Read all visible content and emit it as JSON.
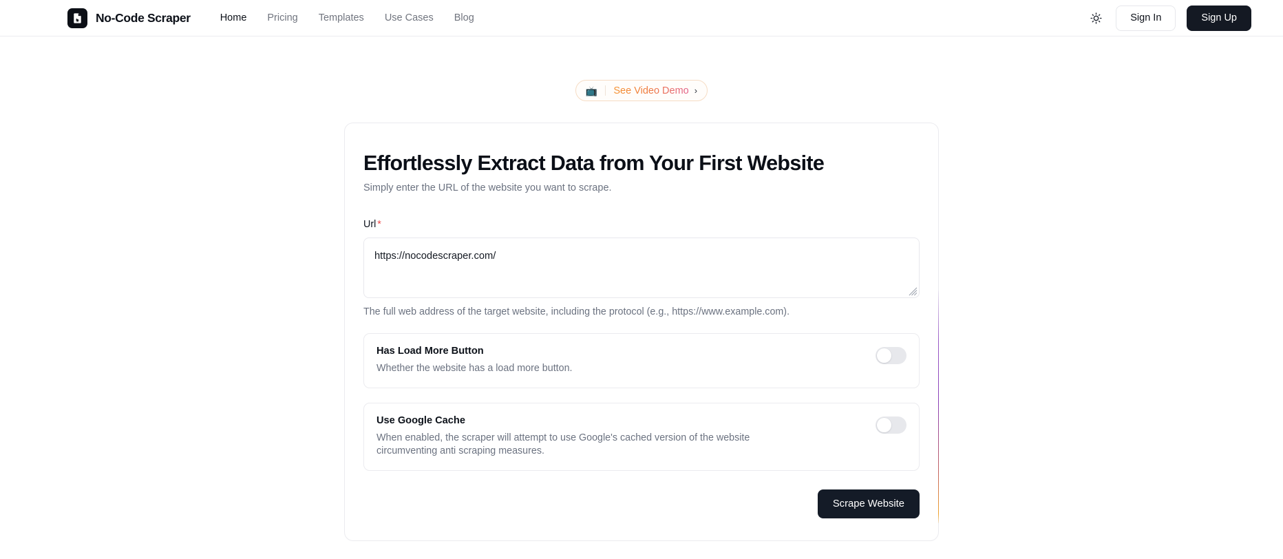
{
  "navbar": {
    "brand": {
      "name": "No-Code Scraper",
      "logo_icon": "document-refresh-icon",
      "logo_bg": "#0c0f16"
    },
    "links": [
      {
        "label": "Home",
        "active": true
      },
      {
        "label": "Pricing",
        "active": false
      },
      {
        "label": "Templates",
        "active": false
      },
      {
        "label": "Use Cases",
        "active": false
      },
      {
        "label": "Blog",
        "active": false
      }
    ],
    "theme_toggle_icon": "sun-icon",
    "sign_in_label": "Sign In",
    "sign_up_label": "Sign Up",
    "sign_up_bg": "#141923"
  },
  "demo_badge": {
    "emoji": "📺",
    "emoji_icon": "television-icon",
    "text": "See Video Demo",
    "chevron": "›",
    "chevron_icon": "chevron-right-icon",
    "gradient_from": "#f59331",
    "gradient_to": "#e2628c",
    "border_color": "#f6dcc4"
  },
  "form_card": {
    "title": "Effortlessly Extract Data from Your First Website",
    "subtitle": "Simply enter the URL of the website you want to scrape.",
    "edge_gradient_top": "#9a59c7",
    "edge_gradient_bottom": "#f0a32c",
    "url_field": {
      "label": "Url",
      "required_marker": "*",
      "required_color": "#ec4747",
      "value": "https://nocodescraper.com/",
      "placeholder": "https://www.example.com",
      "help": "The full web address of the target website, including the protocol (e.g., https://www.example.com).",
      "resize_handle_icon": "resize-grip-icon"
    },
    "options": [
      {
        "title": "Has Load More Button",
        "description": "Whether the website has a load more button.",
        "enabled": false,
        "state_label": "off"
      },
      {
        "title": "Use Google Cache",
        "description": "When enabled, the scraper will attempt to use Google's cached version of the website circumventing anti scraping measures.",
        "enabled": false,
        "state_label": "off"
      }
    ],
    "submit_label": "Scrape Website",
    "submit_bg": "#141b27"
  }
}
